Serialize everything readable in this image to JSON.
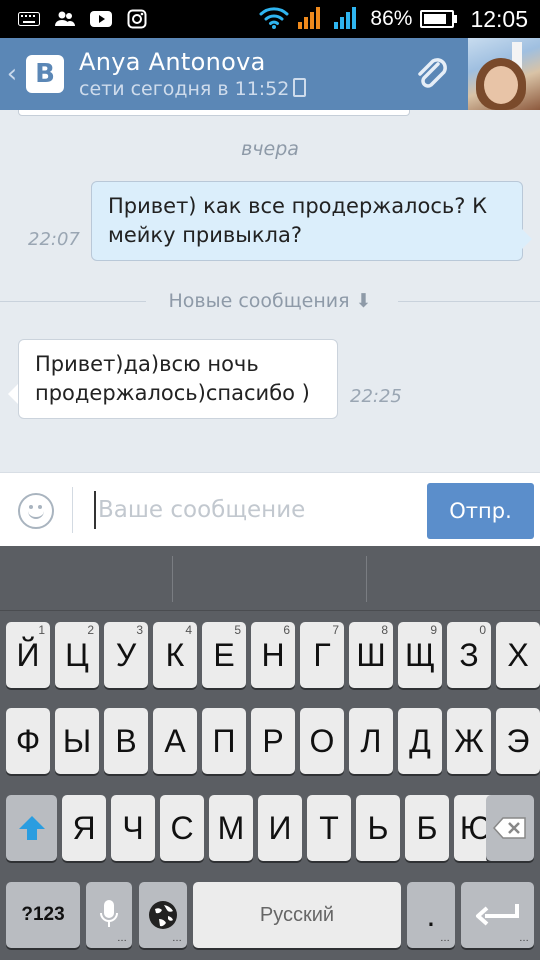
{
  "status_bar": {
    "battery": "86%",
    "time": "12:05",
    "icons": [
      "keyboard-icon",
      "people-icon",
      "youtube-icon",
      "instagram-icon",
      "wifi-icon",
      "signal-icon",
      "signal-icon",
      "battery-icon"
    ]
  },
  "header": {
    "name": "Anya Antonova",
    "status": "сети сегодня в 11:52",
    "icons": [
      "back-chevron-icon",
      "vk-logo",
      "paperclip-icon",
      "avatar"
    ]
  },
  "chat": {
    "day_label": "вчера",
    "messages": [
      {
        "direction": "out",
        "text": "Привет) как все продержалось? К мейку привыкла?",
        "time": "22:07"
      },
      {
        "direction": "in",
        "text": "Привет)да)всю ночь продержалось)спасибо )",
        "time": "22:25"
      }
    ],
    "new_messages_label": "Новые сообщения ⬇"
  },
  "composer": {
    "placeholder": "Ваше сообщение",
    "send_label": "Отпр."
  },
  "keyboard": {
    "row1": [
      {
        "k": "Й",
        "n": "1"
      },
      {
        "k": "Ц",
        "n": "2"
      },
      {
        "k": "У",
        "n": "3"
      },
      {
        "k": "К",
        "n": "4"
      },
      {
        "k": "Е",
        "n": "5"
      },
      {
        "k": "Н",
        "n": "6"
      },
      {
        "k": "Г",
        "n": "7"
      },
      {
        "k": "Ш",
        "n": "8"
      },
      {
        "k": "Щ",
        "n": "9"
      },
      {
        "k": "З",
        "n": "0"
      },
      {
        "k": "Х",
        "n": ""
      }
    ],
    "row2": [
      "Ф",
      "Ы",
      "В",
      "А",
      "П",
      "Р",
      "О",
      "Л",
      "Д",
      "Ж",
      "Э"
    ],
    "row3": [
      "Я",
      "Ч",
      "С",
      "М",
      "И",
      "Т",
      "Ь",
      "Б",
      "Ю"
    ],
    "symbols_label": "?123",
    "space_label": "Русский",
    "period_label": "."
  }
}
